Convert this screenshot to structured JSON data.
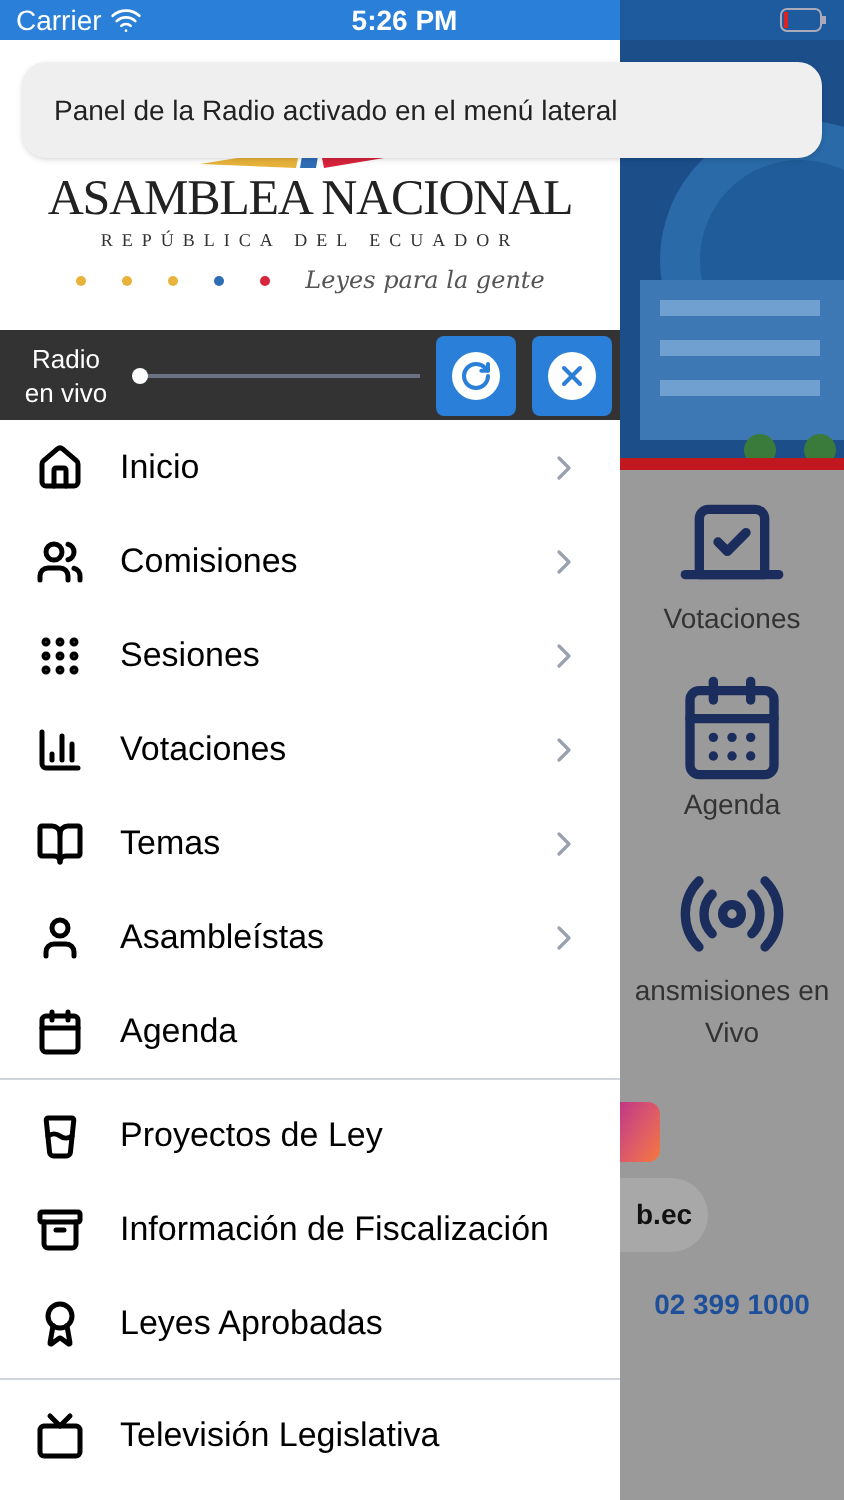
{
  "status_bar": {
    "carrier": "Carrier",
    "time": "5:26 PM"
  },
  "toast": {
    "text": "Panel de la Radio activado en el menú lateral"
  },
  "logo": {
    "title": "ASAMBLEA NACIONAL",
    "subtitle": "REPÚBLICA DEL ECUADOR",
    "tagline": "Leyes para la gente",
    "dots": [
      {
        "color": "#e8b33a"
      },
      {
        "color": "#e8b33a"
      },
      {
        "color": "#e8b33a"
      },
      {
        "color": "#2f6db5"
      },
      {
        "color": "#d8243c"
      }
    ]
  },
  "radio": {
    "label": "Radio en vivo",
    "level": 0.0
  },
  "menu_groups": [
    [
      {
        "label": "Inicio",
        "kind": "home",
        "chevron": true
      },
      {
        "label": "Comisiones",
        "kind": "users",
        "chevron": true
      },
      {
        "label": "Sesiones",
        "kind": "grid",
        "chevron": true
      },
      {
        "label": "Votaciones",
        "kind": "bars",
        "chevron": true
      },
      {
        "label": "Temas",
        "kind": "book",
        "chevron": true
      },
      {
        "label": "Asambleístas",
        "kind": "person",
        "chevron": true
      },
      {
        "label": "Agenda",
        "kind": "calendar",
        "chevron": false
      }
    ],
    [
      {
        "label": "Proyectos de Ley",
        "kind": "glass",
        "chevron": false
      },
      {
        "label": "Información de Fiscalización",
        "kind": "archive",
        "chevron": false
      },
      {
        "label": "Leyes Aprobadas",
        "kind": "badge",
        "chevron": false
      }
    ],
    [
      {
        "label": "Televisión Legislativa",
        "kind": "tv",
        "chevron": false
      }
    ]
  ],
  "background_screen": {
    "tiles": [
      {
        "label": "Votaciones",
        "kind": "vote"
      },
      {
        "label": "Agenda",
        "kind": "calendar"
      },
      {
        "label": "ansmisiones en Vivo",
        "kind": "broadcast"
      }
    ],
    "link": "b.ec",
    "phone": "02 399 1000"
  }
}
